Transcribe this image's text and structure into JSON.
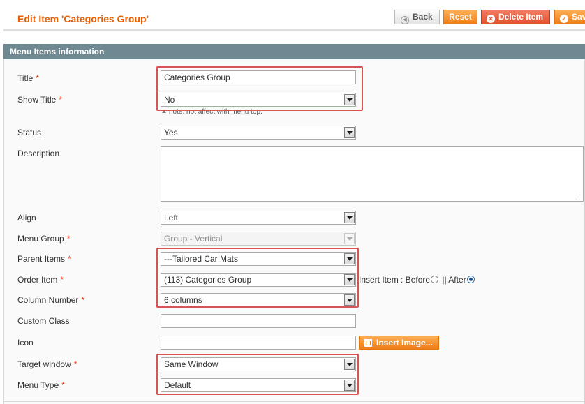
{
  "header": {
    "title": "Edit Item 'Categories Group'",
    "buttons": {
      "back": "Back",
      "reset": "Reset",
      "delete": "Delete Item",
      "save": "Save"
    }
  },
  "section": {
    "title": "Menu Items information"
  },
  "form": {
    "title": {
      "label": "Title",
      "value": "Categories Group"
    },
    "show_title": {
      "label": "Show Title",
      "value": "No",
      "note": "note: not affect with menu top."
    },
    "status": {
      "label": "Status",
      "value": "Yes"
    },
    "description": {
      "label": "Description",
      "value": ""
    },
    "align": {
      "label": "Align",
      "value": "Left"
    },
    "menu_group": {
      "label": "Menu Group",
      "value": "Group - Vertical"
    },
    "parent_items": {
      "label": "Parent Items",
      "value": "---Tailored Car Mats"
    },
    "order_item": {
      "label": "Order Item",
      "value": "(113) Categories Group",
      "insert_label": "Insert Item : Before",
      "after_label": "|| After",
      "selected": "After"
    },
    "column_number": {
      "label": "Column Number",
      "value": "6 columns"
    },
    "custom_class": {
      "label": "Custom Class",
      "value": ""
    },
    "icon": {
      "label": "Icon",
      "value": "",
      "button": "Insert Image..."
    },
    "target_window": {
      "label": "Target window",
      "value": "Same Window"
    },
    "menu_type": {
      "label": "Menu Type",
      "value": "Default"
    },
    "required_mark": "*"
  },
  "colors": {
    "accent": "#eb5e00",
    "section_header": "#6f8992",
    "highlight": "#d9534f",
    "required": "#eb340a"
  },
  "icons": {
    "back": "circle-left-arrow-icon",
    "delete": "delete-circle-icon",
    "save": "check-circle-icon",
    "insert_image": "image-icon"
  }
}
